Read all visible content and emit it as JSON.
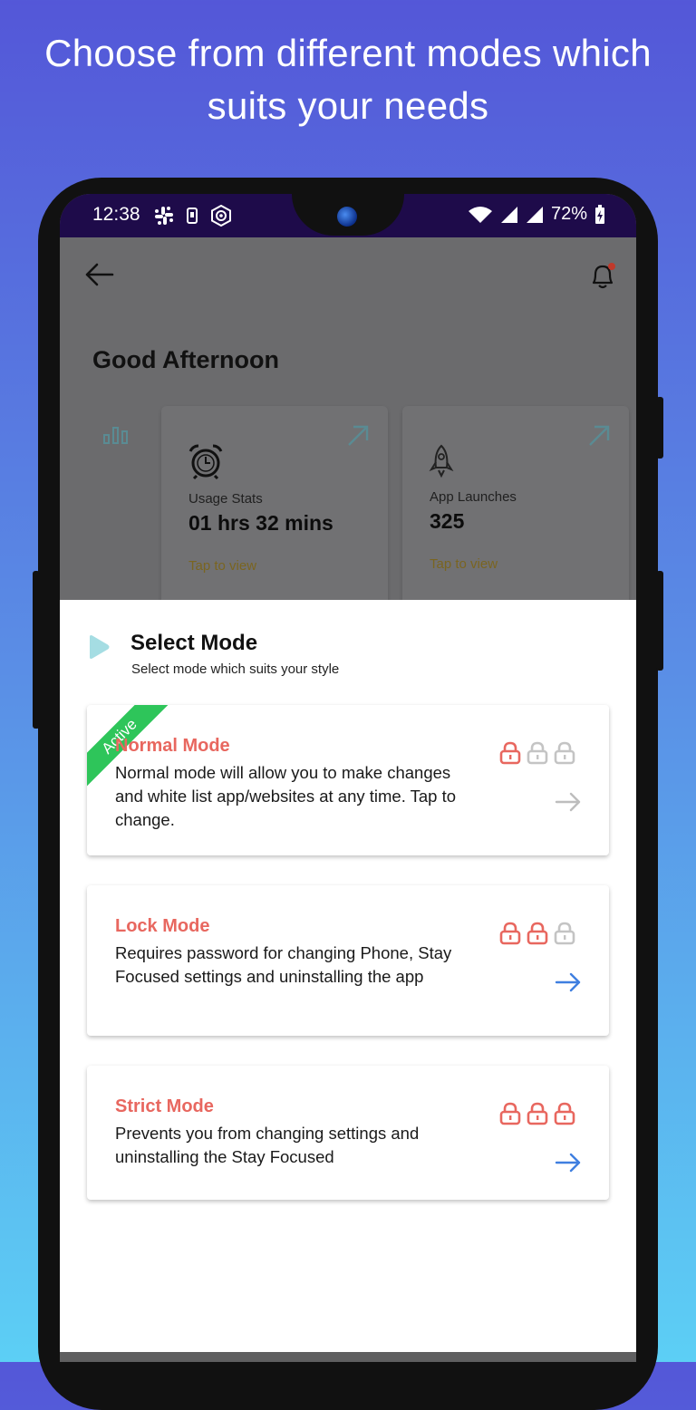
{
  "headline": "Choose from different modes which suits your needs",
  "status_bar": {
    "time": "12:38",
    "battery": "72%"
  },
  "greeting": "Good Afternoon",
  "stats": [
    {
      "label": "Usage Stats",
      "value": "01 hrs 32 mins",
      "tap": "Tap to view",
      "icon": "alarm-clock-icon"
    },
    {
      "label": "App Launches",
      "value": "325",
      "tap": "Tap to view",
      "icon": "rocket-icon"
    }
  ],
  "sheet": {
    "title": "Select Mode",
    "subtitle": "Select mode which suits your style"
  },
  "modes": [
    {
      "title": "Normal Mode",
      "desc": "Normal mode will allow you to make changes and white list app/websites at any time. Tap to change.",
      "badge": "Active",
      "locks_active": 1,
      "arrow_color": "#bdbdbd"
    },
    {
      "title": "Lock Mode",
      "desc": "Requires password for changing Phone, Stay Focused settings and uninstalling the app",
      "locks_active": 2,
      "arrow_color": "#3f7fe0"
    },
    {
      "title": "Strict Mode",
      "desc": "Prevents you from changing settings and uninstalling the Stay Focused",
      "locks_active": 3,
      "arrow_color": "#3f7fe0"
    }
  ],
  "colors": {
    "accent": "#e8675f",
    "active_badge": "#2ec55a",
    "lock_inactive": "#c4c4c4",
    "status_bar": "#1e0b4a"
  }
}
